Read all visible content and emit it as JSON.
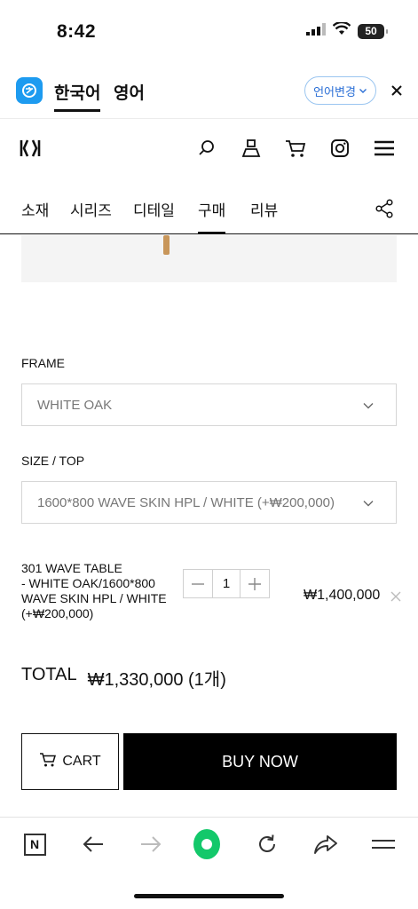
{
  "status_bar": {
    "time": "8:42",
    "battery": "50"
  },
  "lang_bar": {
    "tabs": [
      {
        "label": "한국어"
      },
      {
        "label": "영어"
      }
    ],
    "change_button": "언어변경"
  },
  "header": {
    "icons": [
      "search-icon",
      "user-icon",
      "cart-icon",
      "instagram-icon",
      "menu-icon"
    ]
  },
  "tabs": [
    {
      "label": "소재"
    },
    {
      "label": "시리즈"
    },
    {
      "label": "디테일"
    },
    {
      "label": "구매"
    },
    {
      "label": "리뷰"
    }
  ],
  "options": {
    "frame": {
      "label": "FRAME",
      "value": "WHITE OAK"
    },
    "size": {
      "label": "SIZE / TOP",
      "value": "1600*800 WAVE SKIN HPL / WHITE (+₩200,000)"
    }
  },
  "order_item": {
    "name": "301 WAVE TABLE\n- WHITE OAK/1600*800 WAVE SKIN HPL / WHITE (+₩200,000)",
    "quantity": "1",
    "price": "₩1,400,000"
  },
  "total": {
    "label": "TOTAL",
    "amount": "₩1,330,000 (1개)"
  },
  "actions": {
    "cart": "CART",
    "buy_now": "BUY NOW"
  },
  "colors": {
    "accent": "#1d9bf0",
    "link_blue": "#2b6fd6",
    "naver_green": "#13c86a",
    "buy_bg": "#000000"
  }
}
